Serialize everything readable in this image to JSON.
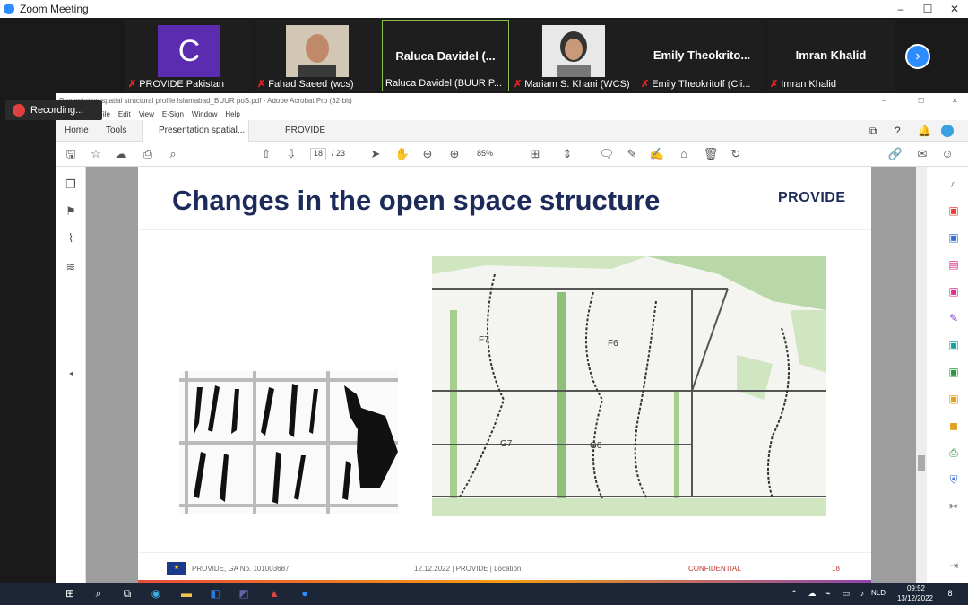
{
  "zoom": {
    "window_title": "Zoom Meeting",
    "participants": [
      {
        "display": "C",
        "caption": "PROVIDE Pakistan"
      },
      {
        "display": "",
        "caption": "Fahad Saeed (wcs)"
      },
      {
        "display": "Raluca Davidel (...",
        "caption": "Raluca Davidel (BUUR P..."
      },
      {
        "display": "",
        "caption": "Mariam S. Khani (WCS)"
      },
      {
        "display": "Emily Theokrito...",
        "caption": "Emily Theokritoff (Cli..."
      },
      {
        "display": "Imran Khalid",
        "caption": "Imran Khalid"
      }
    ],
    "recording_label": "Recording..."
  },
  "acrobat": {
    "window_title": "Presentation spatial structural profile Islamabad_BUUR poS.pdf - Adobe Acrobat Pro (32-bit)",
    "menu": [
      "File",
      "Edit",
      "View",
      "E-Sign",
      "Window",
      "Help"
    ],
    "tabs": {
      "home": "Home",
      "tools": "Tools",
      "doc": "Presentation spatial...",
      "provide": "PROVIDE"
    },
    "page_current": "18",
    "page_total": "/ 23",
    "zoom": "85%"
  },
  "slide": {
    "title": "Changes in the open space structure",
    "logo": "PROVIDE",
    "map_labels": [
      "F7",
      "F6",
      "G7",
      "G6"
    ],
    "footer_left": "PROVIDE, GA No. 101003687",
    "footer_center": "12.12.2022 | PROVIDE | Location",
    "footer_conf": "CONFIDENTIAL",
    "footer_page": "18",
    "accent": "#c0392b"
  },
  "taskbar": {
    "lang": "NLD",
    "time": "09:52",
    "date": "13/12/2022",
    "notif_count": "8"
  }
}
